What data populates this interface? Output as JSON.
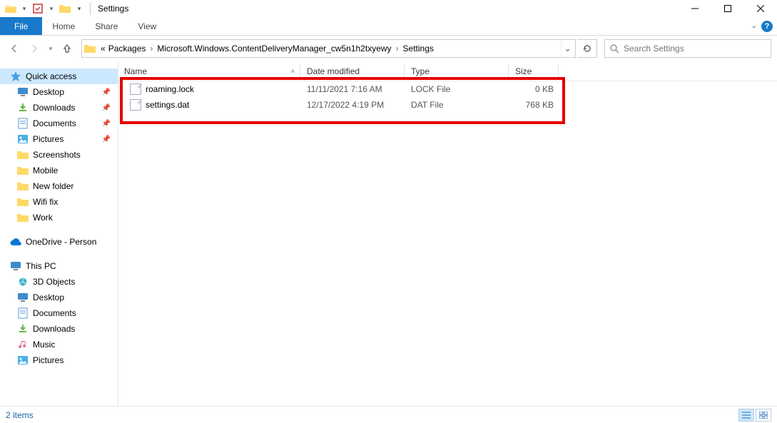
{
  "window": {
    "title": "Settings"
  },
  "ribbon": {
    "file": "File",
    "tabs": [
      "Home",
      "Share",
      "View"
    ]
  },
  "breadcrumbs": {
    "prefix": "«",
    "items": [
      "Packages",
      "Microsoft.Windows.ContentDeliveryManager_cw5n1h2txyewy",
      "Settings"
    ]
  },
  "search": {
    "placeholder": "Search Settings"
  },
  "navtree": {
    "quick_access": {
      "label": "Quick access",
      "items": [
        {
          "label": "Desktop",
          "icon": "desktop",
          "pinned": true
        },
        {
          "label": "Downloads",
          "icon": "downloads",
          "pinned": true
        },
        {
          "label": "Documents",
          "icon": "documents",
          "pinned": true
        },
        {
          "label": "Pictures",
          "icon": "pictures",
          "pinned": true
        },
        {
          "label": "Screenshots",
          "icon": "folder",
          "pinned": false
        },
        {
          "label": "Mobile",
          "icon": "folder",
          "pinned": false
        },
        {
          "label": "New folder",
          "icon": "folder",
          "pinned": false
        },
        {
          "label": "Wifi fix",
          "icon": "folder",
          "pinned": false
        },
        {
          "label": "Work",
          "icon": "folder",
          "pinned": false
        }
      ]
    },
    "onedrive": {
      "label": "OneDrive - Person"
    },
    "thispc": {
      "label": "This PC",
      "items": [
        {
          "label": "3D Objects",
          "icon": "3d"
        },
        {
          "label": "Desktop",
          "icon": "desktop"
        },
        {
          "label": "Documents",
          "icon": "documents"
        },
        {
          "label": "Downloads",
          "icon": "downloads"
        },
        {
          "label": "Music",
          "icon": "music"
        },
        {
          "label": "Pictures",
          "icon": "pictures"
        }
      ]
    }
  },
  "columns": {
    "name": "Name",
    "date": "Date modified",
    "type": "Type",
    "size": "Size"
  },
  "files": [
    {
      "name": "roaming.lock",
      "date": "11/11/2021 7:16 AM",
      "type": "LOCK File",
      "size": "0 KB"
    },
    {
      "name": "settings.dat",
      "date": "12/17/2022 4:19 PM",
      "type": "DAT File",
      "size": "768 KB"
    }
  ],
  "status": {
    "text": "2 items"
  }
}
